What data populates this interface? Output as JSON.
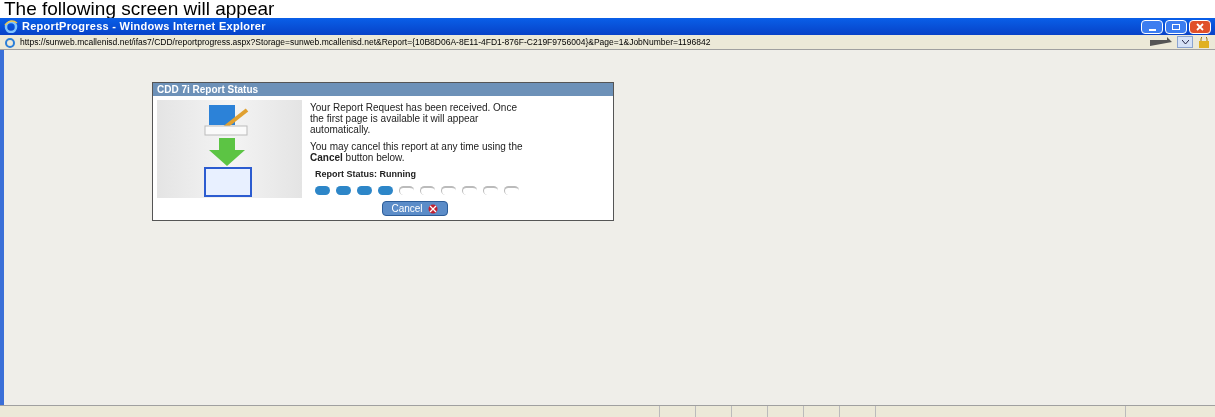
{
  "caption": "The following screen will appear",
  "window": {
    "title": "ReportProgress - Windows Internet Explorer"
  },
  "address_bar": {
    "url": "https://sunweb.mcallenisd.net/ifas7/CDD/reportprogress.aspx?Storage=sunweb.mcallenisd.net&Report={10B8D06A-8E11-4FD1-876F-C219F9756004}&Page=1&JobNumber=1196842"
  },
  "dialog": {
    "title": "CDD 7i Report Status",
    "message": "Your Report Request has been received. Once the first page is available it will appear automatically.",
    "cancel_note": "You may cancel this report at any time using the **Cancel** button below.",
    "status_label": "Report Status: Running",
    "steps": [
      {
        "done": true
      },
      {
        "done": true
      },
      {
        "done": true
      },
      {
        "done": true
      },
      {
        "done": false
      },
      {
        "done": false
      },
      {
        "done": false
      },
      {
        "done": false
      },
      {
        "done": false
      },
      {
        "done": false
      }
    ],
    "button": "Cancel"
  }
}
